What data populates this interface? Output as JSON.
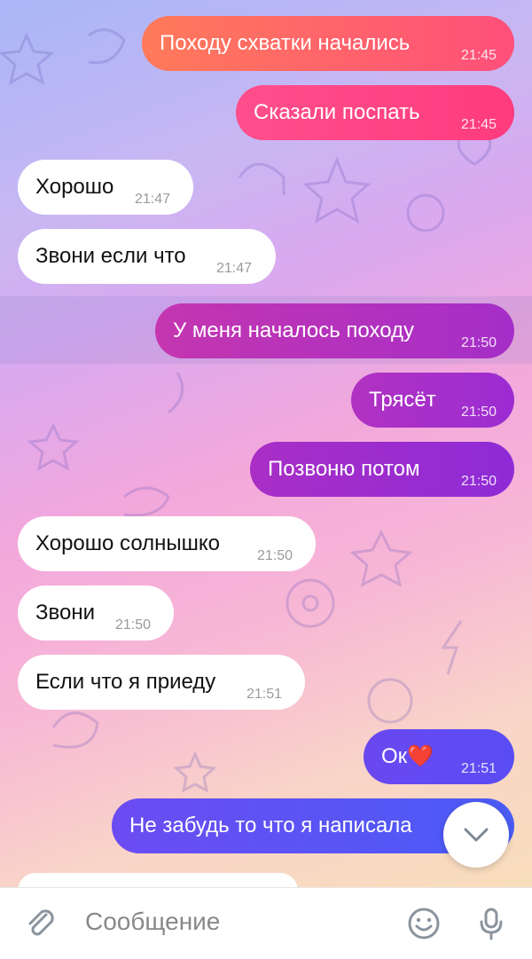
{
  "messages": [
    {
      "dir": "out",
      "text": "Походу схватки начались",
      "time": "21:45"
    },
    {
      "dir": "out",
      "text": "Сказали поспать",
      "time": "21:45"
    },
    {
      "dir": "in",
      "text": "Хорошо",
      "time": "21:47"
    },
    {
      "dir": "in",
      "text": "Звони если что",
      "time": "21:47"
    },
    {
      "dir": "out",
      "text": "У меня началось походу",
      "time": "21:50"
    },
    {
      "dir": "out",
      "text": "Трясёт",
      "time": "21:50"
    },
    {
      "dir": "out",
      "text": "Позвоню потом",
      "time": "21:50"
    },
    {
      "dir": "in",
      "text": "Хорошо солнышко",
      "time": "21:50"
    },
    {
      "dir": "in",
      "text": "Звони",
      "time": "21:50"
    },
    {
      "dir": "in",
      "text": "Если что я приеду",
      "time": "21:51"
    },
    {
      "dir": "out",
      "text": "Ок❤️",
      "time": "21:51"
    },
    {
      "dir": "out",
      "text": "Не забудь то что я написала",
      "time": ""
    }
  ],
  "composer": {
    "placeholder": "Сообщение",
    "icons": [
      "attach-icon",
      "emoji-icon",
      "microphone-icon"
    ]
  },
  "scroll_down_icon": "chevron-down-icon"
}
